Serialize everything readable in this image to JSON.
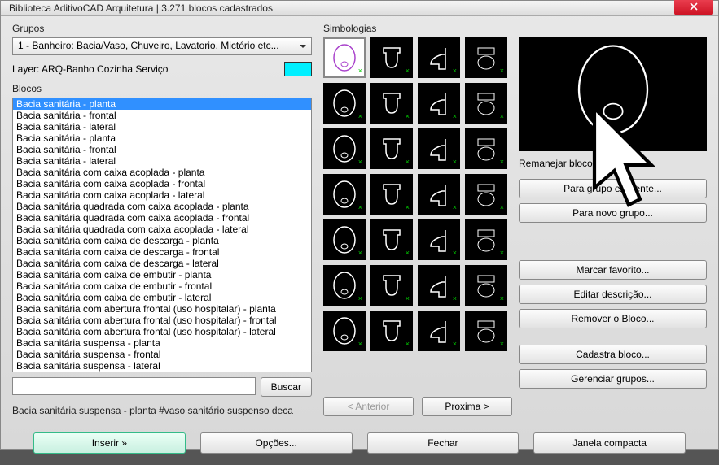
{
  "window": {
    "title": "Biblioteca AditivoCAD Arquitetura |  3.271 blocos cadastrados"
  },
  "grupos": {
    "label": "Grupos",
    "selected": "1 - Banheiro: Bacia/Vaso, Chuveiro, Lavatorio, Mictório etc..."
  },
  "layer": {
    "label": "Layer: ARQ-Banho Cozinha Serviço",
    "color": "#00f0ff"
  },
  "blocos": {
    "label": "Blocos",
    "items": [
      "Bacia sanitária - planta",
      "Bacia sanitária - frontal",
      "Bacia sanitária - lateral",
      "Bacia sanitária - planta",
      "Bacia sanitária - frontal",
      "Bacia sanitária - lateral",
      "Bacia sanitária com caixa acoplada - planta",
      "Bacia sanitária com caixa acoplada - frontal",
      "Bacia sanitária com caixa acoplada - lateral",
      "Bacia sanitária quadrada com caixa acoplada - planta",
      "Bacia sanitária quadrada com caixa acoplada - frontal",
      "Bacia sanitária quadrada com caixa acoplada - lateral",
      "Bacia sanitária com caixa de descarga - planta",
      "Bacia sanitária com caixa de descarga - frontal",
      "Bacia sanitária com caixa de descarga - lateral",
      "Bacia sanitária com caixa de embutir - planta",
      "Bacia sanitária com caixa de embutir - frontal",
      "Bacia sanitária com caixa de embutir - lateral",
      "Bacia sanitária com abertura frontal (uso hospitalar) - planta",
      "Bacia sanitária com abertura frontal (uso hospitalar) - frontal",
      "Bacia sanitária com abertura frontal (uso hospitalar) - lateral",
      "Bacia sanitária suspensa - planta",
      "Bacia sanitária suspensa - frontal",
      "Bacia sanitária suspensa - lateral"
    ],
    "selected_index": 0
  },
  "search": {
    "button": "Buscar",
    "value": ""
  },
  "status": "Bacia sanitária suspensa - planta     #vaso sanitário suspenso deca",
  "simbologias": {
    "label": "Simbologias",
    "selected_index": 0,
    "nav_prev": "< Anterior",
    "nav_next": "Proxima >"
  },
  "remanejar": {
    "label": "Remanejar bloco",
    "btn_existente": "Para grupo existente...",
    "btn_novo": "Para novo grupo..."
  },
  "actions": {
    "favorito": "Marcar favorito...",
    "descricao": "Editar descrição...",
    "remover": "Remover o Bloco...",
    "cadastra": "Cadastra bloco...",
    "gerenciar": "Gerenciar grupos..."
  },
  "bottom": {
    "inserir": "Inserir  »",
    "opcoes": "Opções...",
    "fechar": "Fechar",
    "compacta": "Janela compacta"
  }
}
